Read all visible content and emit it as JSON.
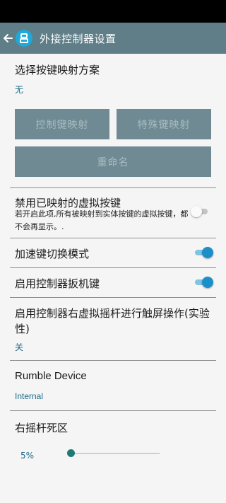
{
  "header": {
    "title": "外接控制器设置",
    "logo_text": "吕",
    "back_icon": "arrow-left-icon",
    "colors": {
      "app_bar": "#5f7e87",
      "logo": "#1fa9d8",
      "accent": "#1c8fc9"
    }
  },
  "mapping": {
    "title": "选择按键映射方案",
    "value": "无",
    "buttons": {
      "control_key": "控制键映射",
      "special_key": "特殊键映射",
      "rename": "重命名"
    }
  },
  "settings": {
    "disable_mapped": {
      "title": "禁用已映射的虚拟按键",
      "description": "若开启此项,所有被映射到实体按键的虚拟按键，都不会再显示。.",
      "enabled": false
    },
    "accelerate_switch": {
      "title": "加速键切换模式",
      "enabled": true
    },
    "trigger_keys": {
      "title": "启用控制器扳机键",
      "enabled": true
    },
    "right_stick_touch": {
      "title": "启用控制器右虚拟摇杆进行触屏操作(实验性)",
      "value": "关"
    },
    "rumble": {
      "title": "Rumble Device",
      "value": "Internal"
    },
    "deadzone": {
      "title": "右摇杆死区",
      "value": "5%",
      "level": 0.05
    }
  }
}
